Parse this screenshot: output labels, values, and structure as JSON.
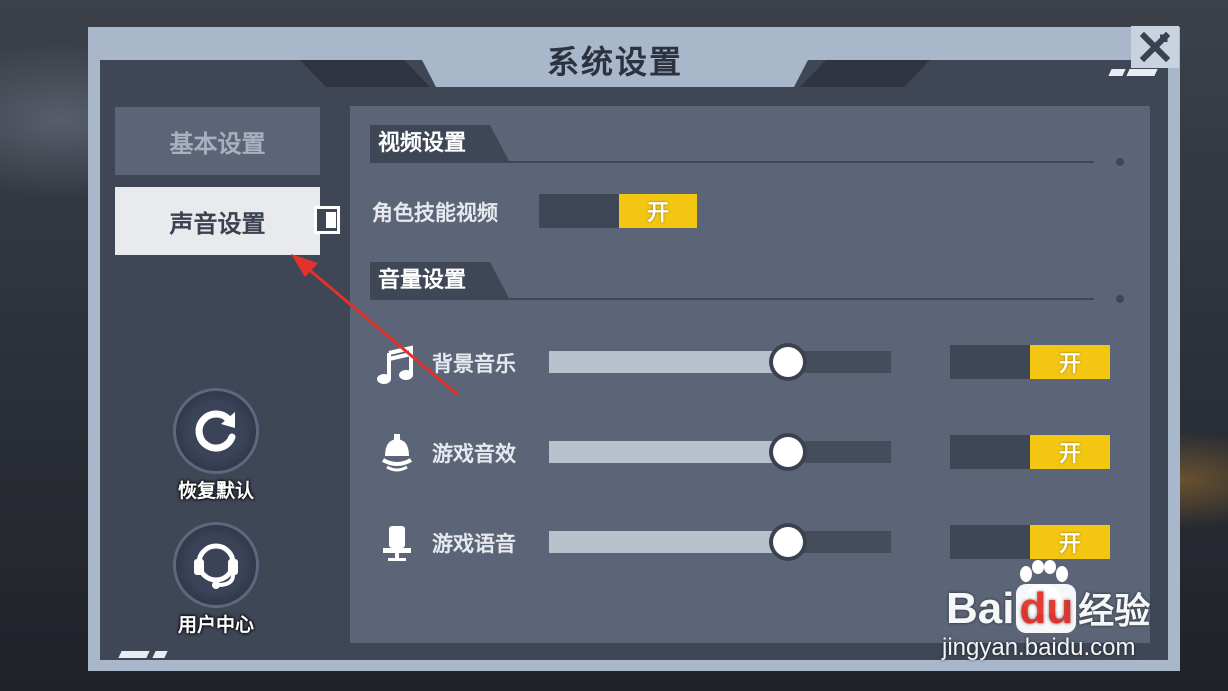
{
  "dialog": {
    "title": "系统设置",
    "close_icon": "close-x-icon"
  },
  "sidebar": {
    "tabs": [
      {
        "label": "基本设置",
        "selected": false
      },
      {
        "label": "声音设置",
        "selected": true
      }
    ],
    "buttons": [
      {
        "label": "恢复默认",
        "icon": "refresh-icon"
      },
      {
        "label": "用户中心",
        "icon": "headset-icon"
      }
    ]
  },
  "video_section": {
    "title": "视频设置",
    "rows": [
      {
        "label": "角色技能视频",
        "toggle_label": "开",
        "toggle_on": true
      }
    ]
  },
  "volume_section": {
    "title": "音量设置",
    "rows": [
      {
        "label": "背景音乐",
        "icon": "music-note-icon",
        "level": 0.7,
        "toggle_label": "开",
        "toggle_on": true
      },
      {
        "label": "游戏音效",
        "icon": "bell-icon",
        "level": 0.7,
        "toggle_label": "开",
        "toggle_on": true
      },
      {
        "label": "游戏语音",
        "icon": "microphone-icon",
        "level": 0.7,
        "toggle_label": "开",
        "toggle_on": true
      }
    ]
  },
  "colors": {
    "accent_on": "#f3c612",
    "panel": "#5b6577",
    "frame": "#a9b7cb",
    "annotation_arrow": "#e3322b"
  },
  "watermark": {
    "brand_a": "Bai",
    "brand_b": "du",
    "brand_c": "经验",
    "url": "jingyan.baidu.com"
  }
}
